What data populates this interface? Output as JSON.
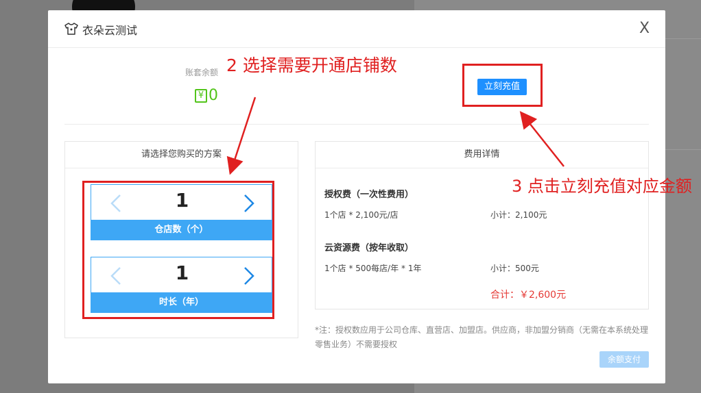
{
  "dialog": {
    "title": "衣朵云测试",
    "close_label": "X"
  },
  "balance": {
    "label": "账套余额",
    "currency_symbol": "¥",
    "amount": "0",
    "recharge_label": "立刻充值"
  },
  "plan_panel": {
    "title": "请选择您购买的方案",
    "steppers": [
      {
        "value": "1",
        "label": "仓店数（个）"
      },
      {
        "value": "1",
        "label": "时长（年）"
      }
    ]
  },
  "cost_panel": {
    "title": "费用详情",
    "license": {
      "title": "授权费（一次性费用）",
      "line": "1个店 * 2,100元/店",
      "subtotal": "小计：2,100元"
    },
    "cloud": {
      "title": "云资源费（按年收取）",
      "line": "1个店 * 500每店/年 * 1年",
      "subtotal": "小计：500元"
    },
    "total": "合计：￥2,600元"
  },
  "note": "*注：授权数应用于公司仓库、直营店、加盟店。供应商，非加盟分销商（无需在本系统处理零售业务）不需要授权",
  "pay_label": "余额支付",
  "annotations": {
    "step2": "2   选择需要开通店铺数",
    "step3": "3 点击立刻充值对应金额"
  },
  "colors": {
    "accent": "#3ea7f5",
    "balance_green": "#52c41a",
    "total_red": "#e53935",
    "annotation_red": "#e02020"
  }
}
